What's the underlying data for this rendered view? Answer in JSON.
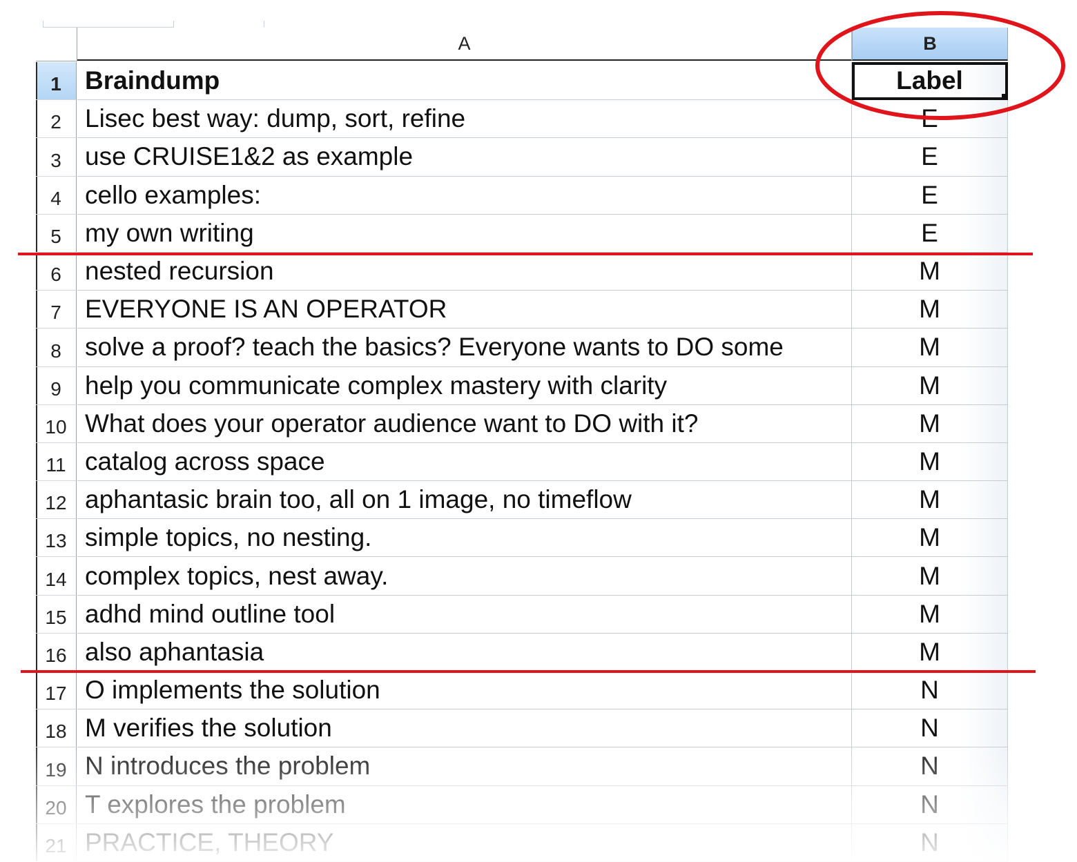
{
  "columns": {
    "a": "A",
    "b": "B"
  },
  "rows": [
    {
      "num": "1",
      "text": "Braindump",
      "label": "Label"
    },
    {
      "num": "2",
      "text": "Lisec best way: dump, sort, refine",
      "label": "E"
    },
    {
      "num": "3",
      "text": "use CRUISE1&2 as example",
      "label": "E"
    },
    {
      "num": "4",
      "text": "cello examples:",
      "label": "E"
    },
    {
      "num": "5",
      "text": "my own writing",
      "label": "E"
    },
    {
      "num": "6",
      "text": "nested recursion",
      "label": "M"
    },
    {
      "num": "7",
      "text": "EVERYONE IS AN OPERATOR",
      "label": "M"
    },
    {
      "num": "8",
      "text": "solve a proof? teach the basics? Everyone wants to DO some",
      "label": "M"
    },
    {
      "num": "9",
      "text": "help you communicate complex mastery with clarity",
      "label": "M"
    },
    {
      "num": "10",
      "text": "What does your operator audience want to DO with it?",
      "label": "M"
    },
    {
      "num": "11",
      "text": "catalog across space",
      "label": "M"
    },
    {
      "num": "12",
      "text": "aphantasic brain too, all on 1 image, no timeflow",
      "label": "M"
    },
    {
      "num": "13",
      "text": "simple topics, no nesting.",
      "label": "M"
    },
    {
      "num": "14",
      "text": "complex topics, nest away.",
      "label": "M"
    },
    {
      "num": "15",
      "text": "adhd mind outline tool",
      "label": "M"
    },
    {
      "num": "16",
      "text": "also aphantasia",
      "label": "M"
    },
    {
      "num": "17",
      "text": "O implements the solution",
      "label": "N"
    },
    {
      "num": "18",
      "text": "M verifies the solution",
      "label": "N"
    },
    {
      "num": "19",
      "text": "N introduces the problem",
      "label": "N"
    },
    {
      "num": "20",
      "text": "T explores the problem",
      "label": "N"
    },
    {
      "num": "21",
      "text": "PRACTICE, THEORY",
      "label": "N"
    }
  ],
  "colors": {
    "annotation": "#e0141b",
    "selected_header": "#b4d6f5"
  }
}
